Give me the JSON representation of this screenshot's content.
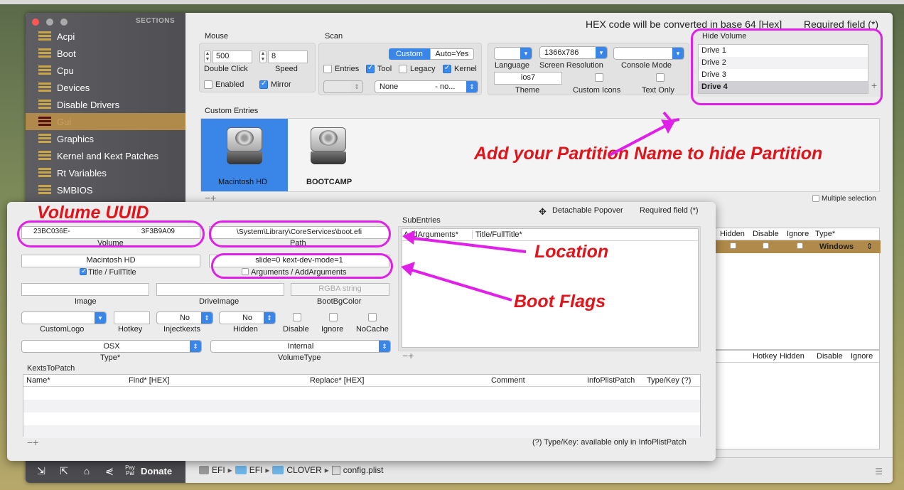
{
  "sidebar": {
    "header": "SECTIONS",
    "items": [
      "Acpi",
      "Boot",
      "Cpu",
      "Devices",
      "Disable Drivers",
      "Gui",
      "Graphics",
      "Kernel and Kext Patches",
      "Rt Variables",
      "SMBIOS"
    ],
    "selected_index": 5
  },
  "top": {
    "hex_note": "HEX code will be converted in base 64 [Hex]",
    "required": "Required field (*)"
  },
  "mouse": {
    "title": "Mouse",
    "double_click": "500",
    "speed": "8",
    "double_click_label": "Double Click",
    "speed_label": "Speed",
    "enabled": "Enabled",
    "mirror": "Mirror"
  },
  "scan": {
    "title": "Scan",
    "custom": "Custom",
    "auto_yes": "Auto=Yes",
    "entries": "Entries",
    "tool": "Tool",
    "legacy": "Legacy",
    "kernel": "Kernel",
    "none_popup": "None",
    "none_suffix": "- no..."
  },
  "gui": {
    "resolution": "1366x786",
    "language": "Language",
    "screen_resolution": "Screen Resolution",
    "console_mode": "Console Mode",
    "theme_value": "ios7",
    "theme": "Theme",
    "custom_icons": "Custom Icons",
    "text_only": "Text Only"
  },
  "hide_volume": {
    "title": "Hide Volume",
    "drives": [
      "Drive 1",
      "Drive 2",
      "Drive 3",
      "Drive 4"
    ],
    "selected_index": 3
  },
  "custom_entries": {
    "title": "Custom Entries",
    "entries": [
      "Macintosh HD",
      "BOOTCAMP"
    ],
    "multiple_selection": "Multiple selection"
  },
  "right_table_headers": [
    "Hidden",
    "Disable",
    "Ignore",
    "Type*"
  ],
  "right_table_value": "Windows",
  "right_table2_headers": [
    "Hotkey",
    "Hidden",
    "Disable",
    "Ignore"
  ],
  "popover": {
    "detachable": "Detachable Popover",
    "required": "Required field (*)",
    "volume_value_a": "23BC036E-",
    "volume_value_b": "3F3B9A09",
    "volume": "Volume",
    "path_value": "\\System\\Library\\CoreServices\\boot.efi",
    "path": "Path",
    "title_value": "Macintosh HD",
    "title_label": "Title / FullTitle",
    "args_value": "slide=0 kext-dev-mode=1",
    "args_label": "Arguments / AddArguments",
    "image": "Image",
    "drive_image": "DriveImage",
    "rgba_placeholder": "RGBA string",
    "boot_bg_color": "BootBgColor",
    "custom_logo": "CustomLogo",
    "hotkey": "Hotkey",
    "inject_kexts_value": "No",
    "inject_kexts": "Injectkexts",
    "hidden_value": "No",
    "hidden": "Hidden",
    "disable": "Disable",
    "ignore": "Ignore",
    "nocache": "NoCache",
    "type_value": "OSX",
    "type": "Type*",
    "volume_type_value": "Internal",
    "volume_type": "VolumeType",
    "subentries": "SubEntries",
    "sub_headers": [
      "AddArguments*",
      "Title/FullTitle*"
    ],
    "kexts_to_patch": "KextsToPatch",
    "kexts_headers": [
      "Name*",
      "Find* [HEX]",
      "Replace* [HEX]",
      "Comment",
      "InfoPlistPatch",
      "Type/Key (?)"
    ],
    "footnote": "(?) Type/Key: available only in InfoPlistPatch"
  },
  "annotations": {
    "hide": "Add your Partition Name to hide  Partition",
    "uuid": "Volume UUID",
    "location": "Location",
    "boot_flags": "Boot Flags"
  },
  "bottom": {
    "donate": "Donate",
    "paypal": "Pay Pal",
    "crumbs": [
      "EFI",
      "EFI",
      "CLOVER",
      "config.plist"
    ]
  }
}
